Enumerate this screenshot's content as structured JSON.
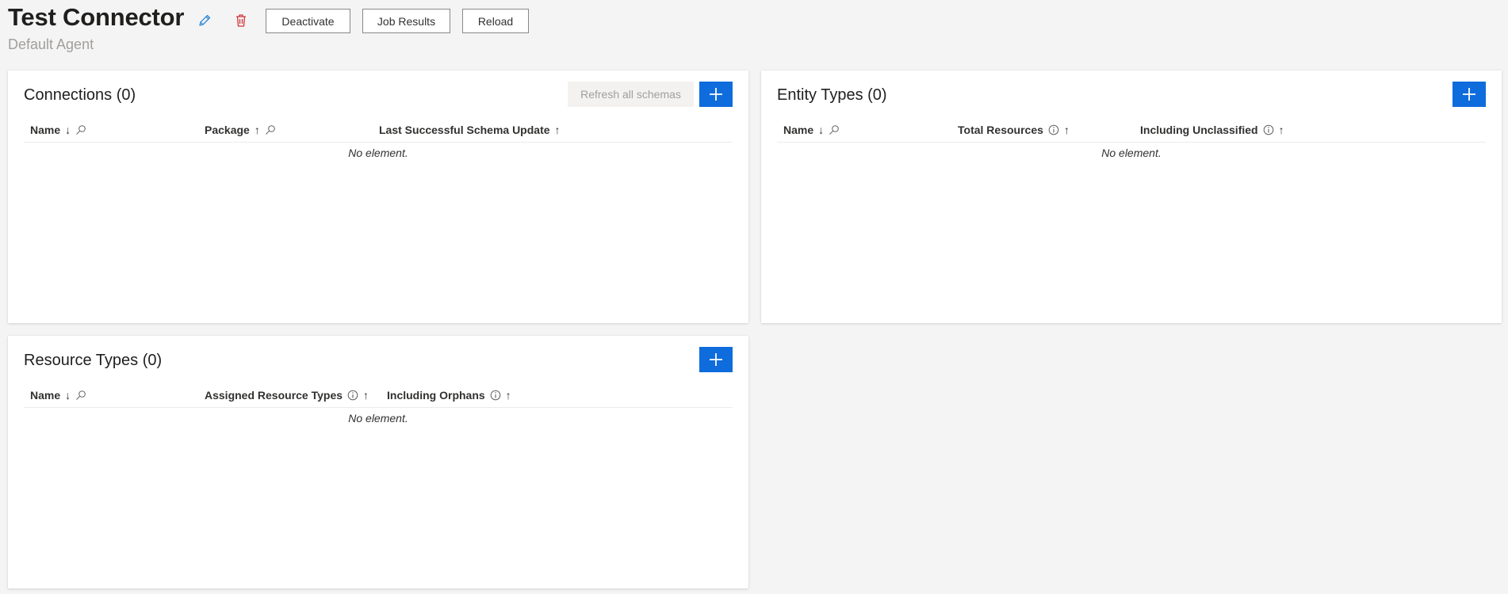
{
  "header": {
    "title": "Test Connector",
    "subtitle": "Default Agent",
    "buttons": {
      "deactivate": "Deactivate",
      "job_results": "Job Results",
      "reload": "Reload"
    },
    "icons": {
      "edit": "pencil-icon",
      "delete": "trash-icon"
    }
  },
  "connections": {
    "title": "Connections (0)",
    "refresh_label": "Refresh all schemas",
    "columns": [
      "Name",
      "Package",
      "Last Successful Schema Update"
    ],
    "sort": [
      "↓",
      "↑",
      "↑"
    ],
    "empty_text": "No element."
  },
  "entity_types": {
    "title": "Entity Types (0)",
    "columns": [
      "Name",
      "Total Resources",
      "Including Unclassified"
    ],
    "sort": [
      "↓",
      "↑",
      "↑"
    ],
    "empty_text": "No element."
  },
  "resource_types": {
    "title": "Resource Types (0)",
    "columns": [
      "Name",
      "Assigned Resource Types",
      "Including Orphans"
    ],
    "sort": [
      "↓",
      "↑",
      "↑"
    ],
    "empty_text": "No element."
  },
  "colors": {
    "accent": "#0f6cdc",
    "delete": "#d13438",
    "background": "#f4f4f4"
  }
}
